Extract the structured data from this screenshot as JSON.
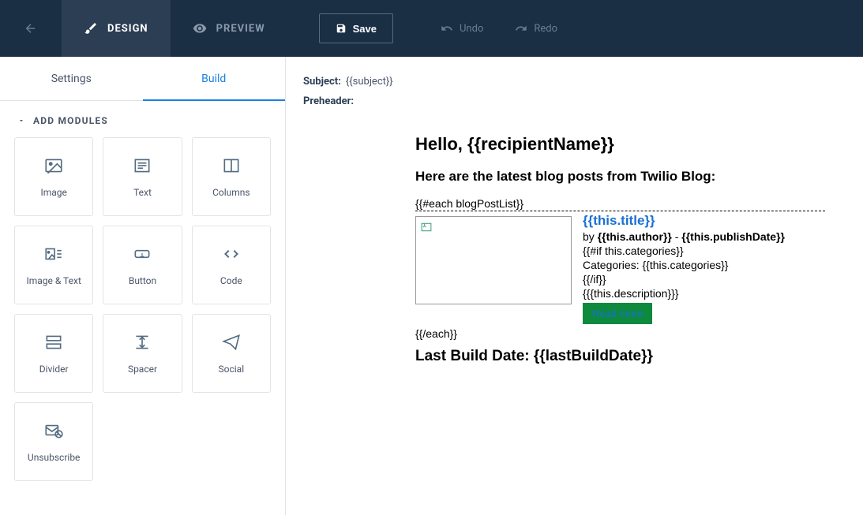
{
  "topbar": {
    "design_label": "DESIGN",
    "preview_label": "PREVIEW",
    "save_label": "Save",
    "undo_label": "Undo",
    "redo_label": "Redo"
  },
  "sidebar": {
    "tabs": {
      "settings": "Settings",
      "build": "Build"
    },
    "section_title": "ADD MODULES",
    "modules": [
      {
        "id": "image",
        "label": "Image"
      },
      {
        "id": "text",
        "label": "Text"
      },
      {
        "id": "columns",
        "label": "Columns"
      },
      {
        "id": "image-text",
        "label": "Image & Text"
      },
      {
        "id": "button",
        "label": "Button"
      },
      {
        "id": "code",
        "label": "Code"
      },
      {
        "id": "divider",
        "label": "Divider"
      },
      {
        "id": "spacer",
        "label": "Spacer"
      },
      {
        "id": "social",
        "label": "Social"
      },
      {
        "id": "unsubscribe",
        "label": "Unsubscribe"
      }
    ]
  },
  "meta": {
    "subject_label": "Subject:",
    "subject_value": "{{subject}}",
    "preheader_label": "Preheader:",
    "preheader_value": ""
  },
  "email": {
    "greeting": "Hello, {{recipientName}}",
    "intro": "Here are the latest blog posts from Twilio Blog:",
    "loop_open": "{{#each blogPostList}}",
    "post": {
      "title": "{{this.title}}",
      "by_prefix": "by ",
      "author": "{{this.author}}",
      "sep": " - ",
      "publish_date": "{{this.publishDate}}",
      "if_cat": "{{#if this.categories}}",
      "categories_line": "Categories: {{this.categories}}",
      "endif": "{{/if}}",
      "description": "{{{this.description}}}",
      "read_more": "Read more"
    },
    "loop_close": "{{/each}}",
    "last_build": "Last Build Date: {{lastBuildDate}}"
  }
}
